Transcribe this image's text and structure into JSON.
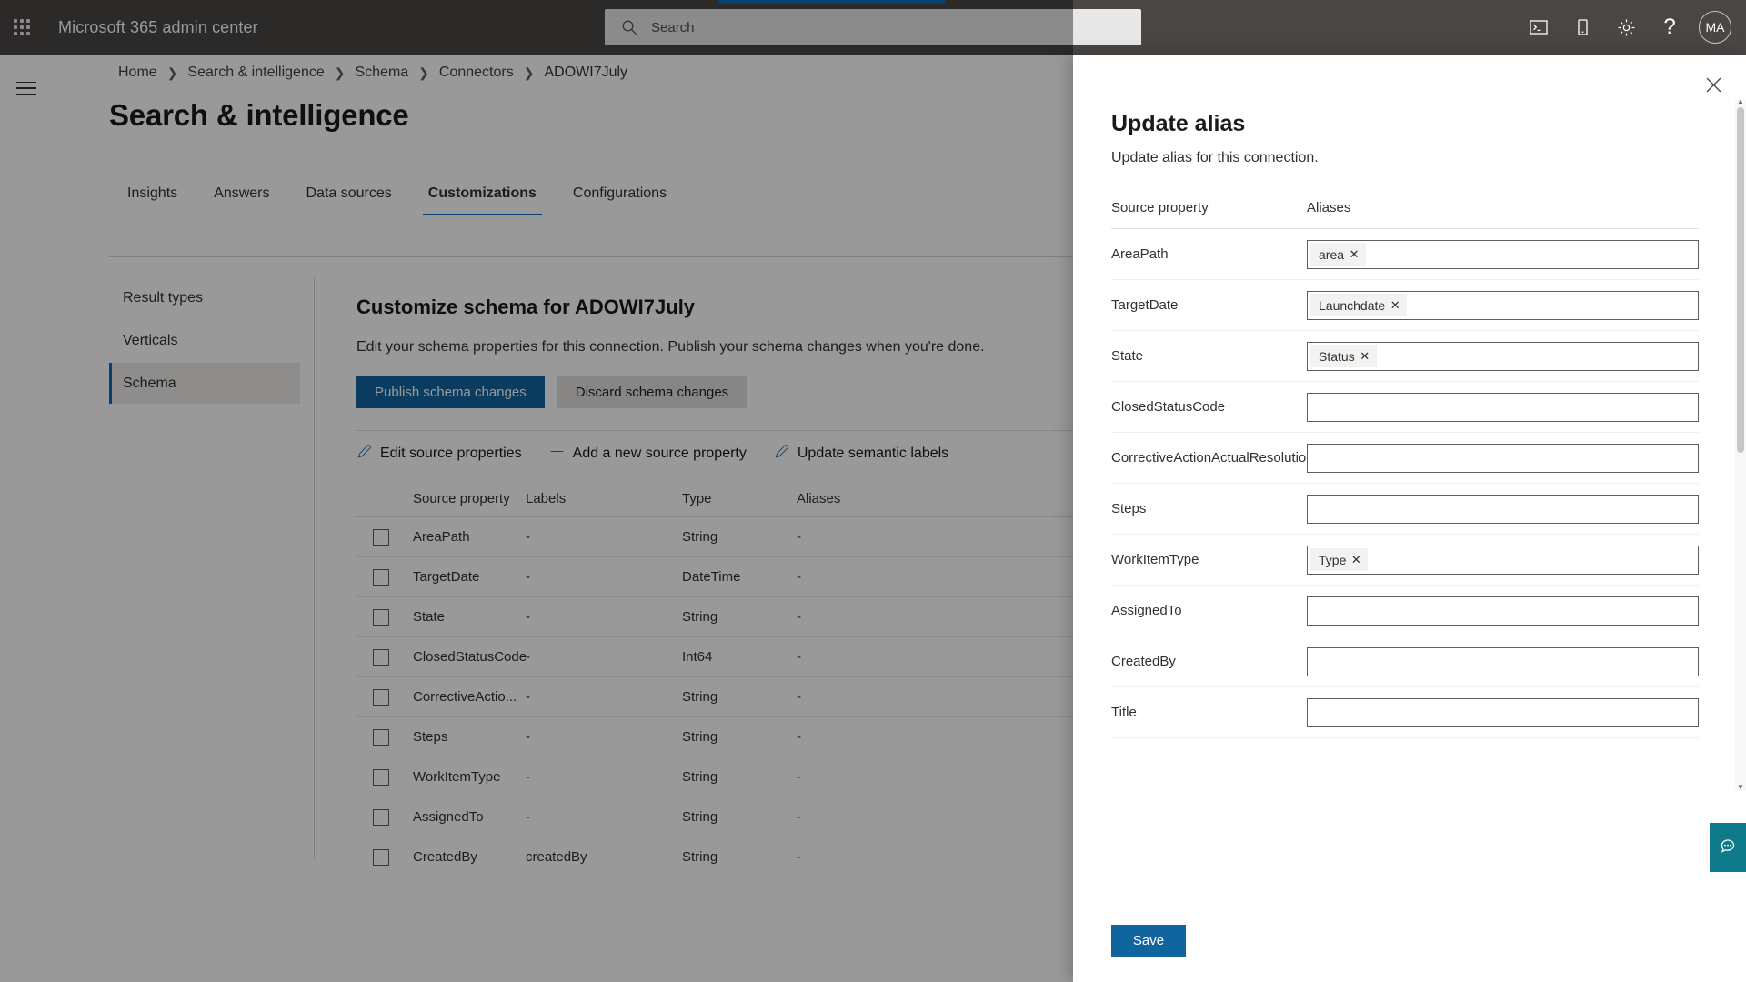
{
  "suite": {
    "title": "Microsoft 365 admin center",
    "waffle_icon": "waffle-icon",
    "search": {
      "placeholder": "Search",
      "value": "",
      "icon": "search-icon"
    },
    "icons": [
      {
        "name": "terminal-icon",
        "glyph": ""
      },
      {
        "name": "mobile-device-icon",
        "glyph": ""
      },
      {
        "name": "gear-icon",
        "glyph": ""
      },
      {
        "name": "help-icon",
        "glyph": "?"
      }
    ],
    "avatar_initials": "MA",
    "accent_color": "#0f6cbd",
    "bar_color": "#4a4644"
  },
  "breadcrumb": [
    "Home",
    "Search & intelligence",
    "Schema",
    "Connectors",
    "ADOWI7July"
  ],
  "page": {
    "title": "Search & intelligence",
    "tabs": [
      {
        "label": "Insights",
        "active": false
      },
      {
        "label": "Answers",
        "active": false
      },
      {
        "label": "Data sources",
        "active": false
      },
      {
        "label": "Customizations",
        "active": true
      },
      {
        "label": "Configurations",
        "active": false
      }
    ],
    "subnav": [
      {
        "label": "Result types",
        "active": false
      },
      {
        "label": "Verticals",
        "active": false
      },
      {
        "label": "Schema",
        "active": true
      }
    ]
  },
  "main": {
    "heading": "Customize schema for ADOWI7July",
    "description": "Edit your schema properties for this connection. Publish your schema changes when you're done.",
    "publish_label": "Publish schema changes",
    "discard_label": "Discard schema changes",
    "commands": [
      {
        "label": "Edit source properties",
        "icon": "pencil-icon"
      },
      {
        "label": "Add a new source property",
        "icon": "plus-icon"
      },
      {
        "label": "Update semantic labels",
        "icon": "pencil-icon"
      }
    ],
    "table": {
      "columns": [
        "Source property",
        "Labels",
        "Type",
        "Aliases"
      ],
      "rows": [
        {
          "property": "AreaPath",
          "labels": "-",
          "type": "String",
          "aliases": "-"
        },
        {
          "property": "TargetDate",
          "labels": "-",
          "type": "DateTime",
          "aliases": "-"
        },
        {
          "property": "State",
          "labels": "-",
          "type": "String",
          "aliases": "-"
        },
        {
          "property": "ClosedStatusCode",
          "labels": "-",
          "type": "Int64",
          "aliases": "-"
        },
        {
          "property": "CorrectiveActio...",
          "labels": "-",
          "type": "String",
          "aliases": "-"
        },
        {
          "property": "Steps",
          "labels": "-",
          "type": "String",
          "aliases": "-"
        },
        {
          "property": "WorkItemType",
          "labels": "-",
          "type": "String",
          "aliases": "-"
        },
        {
          "property": "AssignedTo",
          "labels": "-",
          "type": "String",
          "aliases": "-"
        },
        {
          "property": "CreatedBy",
          "labels": "createdBy",
          "type": "String",
          "aliases": "-"
        }
      ]
    }
  },
  "panel": {
    "title": "Update alias",
    "subtitle": "Update alias for this connection.",
    "close_icon": "close-icon",
    "columns": [
      "Source property",
      "Aliases"
    ],
    "rows": [
      {
        "property": "AreaPath",
        "chips": [
          "area"
        ]
      },
      {
        "property": "TargetDate",
        "chips": [
          "Launchdate"
        ]
      },
      {
        "property": "State",
        "chips": [
          "Status"
        ]
      },
      {
        "property": "ClosedStatusCode",
        "chips": []
      },
      {
        "property": "CorrectiveActionActualResolution",
        "chips": []
      },
      {
        "property": "Steps",
        "chips": []
      },
      {
        "property": "WorkItemType",
        "chips": [
          "Type"
        ]
      },
      {
        "property": "AssignedTo",
        "chips": []
      },
      {
        "property": "CreatedBy",
        "chips": []
      },
      {
        "property": "Title",
        "chips": []
      }
    ],
    "save_label": "Save"
  },
  "feedback": {
    "icon": "feedback-icon",
    "color": "#0f7b8a"
  }
}
